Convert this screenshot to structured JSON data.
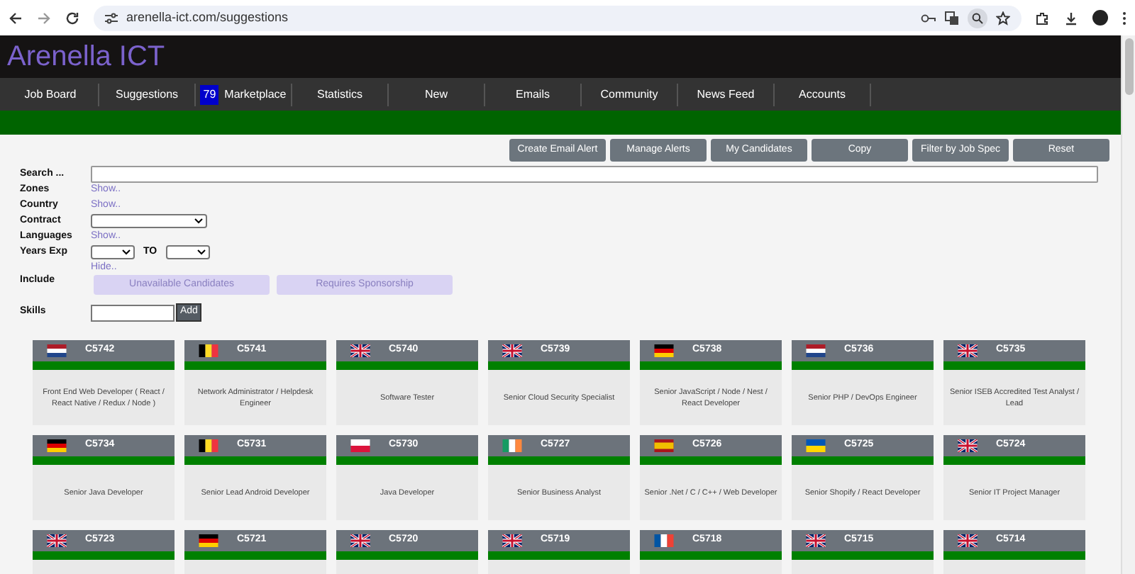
{
  "browser": {
    "url": "arenella-ict.com/suggestions"
  },
  "site_title": "Arenella ICT",
  "nav": [
    {
      "label": "Job Board"
    },
    {
      "label": "Suggestions"
    },
    {
      "label": "Marketplace",
      "badge": "79"
    },
    {
      "label": "Statistics"
    },
    {
      "label": "New"
    },
    {
      "label": "Emails"
    },
    {
      "label": "Community"
    },
    {
      "label": "News Feed"
    },
    {
      "label": "Accounts"
    }
  ],
  "actions": [
    "Create Email Alert",
    "Manage Alerts",
    "My Candidates",
    "Copy",
    "Filter by Job Spec",
    "Reset"
  ],
  "filters": [
    {
      "label": "Search ...",
      "kind": "text"
    },
    {
      "label": "Zones",
      "kind": "link",
      "link": "Show.."
    },
    {
      "label": "Country",
      "kind": "link",
      "link": "Show.."
    },
    {
      "label": "Contract",
      "kind": "select"
    },
    {
      "label": "Languages",
      "kind": "link",
      "link": "Show.."
    },
    {
      "label": "Years Exp",
      "kind": "range",
      "to": "TO"
    }
  ],
  "hide_link": "Hide..",
  "include": {
    "label": "Include",
    "options": [
      {
        "label": "Unavailable Candidates",
        "disabled": true
      },
      {
        "label": "Requires Sponsorship",
        "disabled": true
      }
    ]
  },
  "skills": {
    "label": "Skills",
    "button": "Add"
  },
  "cards": [
    {
      "kind": "nl",
      "id": "C5742",
      "title": "Front End Web Developer ( React / React Native / Redux / Node )"
    },
    {
      "kind": "be",
      "id": "C5741",
      "title": "Network Administrator / Helpdesk Engineer"
    },
    {
      "kind": "gb",
      "id": "C5740",
      "title": "Software Tester"
    },
    {
      "kind": "gb",
      "id": "C5739",
      "title": "Senior Cloud Security Specialist"
    },
    {
      "kind": "de",
      "id": "C5738",
      "title": "Senior JavaScript / Node / Nest / React Developer"
    },
    {
      "kind": "nl",
      "id": "C5736",
      "title": "Senior PHP / DevOps Engineer"
    },
    {
      "kind": "gb",
      "id": "C5735",
      "title": "Senior ISEB Accredited Test Analyst / Lead"
    },
    {
      "kind": "de",
      "id": "C5734",
      "title": "Senior Java Developer"
    },
    {
      "kind": "be",
      "id": "C5731",
      "title": "Senior Lead Android Developer"
    },
    {
      "kind": "pl",
      "id": "C5730",
      "title": "Java Developer"
    },
    {
      "kind": "ie",
      "id": "C5727",
      "title": "Senior Business Analyst"
    },
    {
      "kind": "es",
      "id": "C5726",
      "title": "Senior .Net / C / C++ / Web Developer"
    },
    {
      "kind": "ua",
      "id": "C5725",
      "title": "Senior Shopify / React Developer"
    },
    {
      "kind": "gb",
      "id": "C5724",
      "title": "Senior IT Project Manager"
    },
    {
      "kind": "gb",
      "id": "C5723"
    },
    {
      "kind": "de",
      "id": "C5721"
    },
    {
      "kind": "gb",
      "id": "C5720"
    },
    {
      "kind": "gb",
      "id": "C5719"
    },
    {
      "kind": "fr",
      "id": "C5718"
    },
    {
      "kind": "gb",
      "id": "C5715"
    },
    {
      "kind": "gb",
      "id": "C5714"
    }
  ]
}
